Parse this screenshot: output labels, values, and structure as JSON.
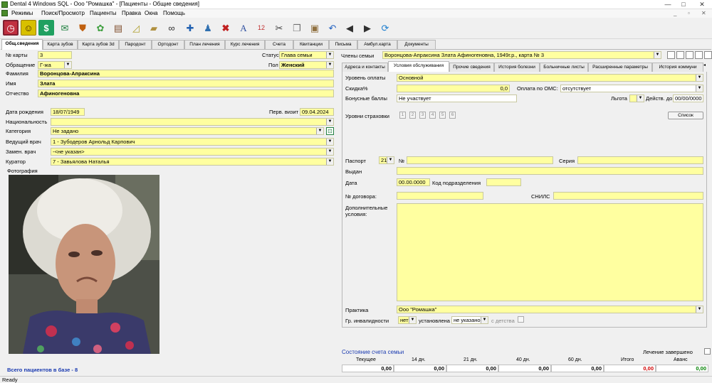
{
  "window": {
    "title": "Dental 4 Windows SQL - Ооо \"Ромашка\" - [Пациенты - Общие сведения]"
  },
  "menu": [
    "Режимы",
    "Поиск/Просмотр",
    "Пациенты",
    "Правка",
    "Окна",
    "Помощь"
  ],
  "toolbar_icons": [
    "clock-icon",
    "smiley-icon",
    "dollar-icon",
    "envelope-icon",
    "shield-icon",
    "gears-icon",
    "clipboard-icon",
    "chart-icon",
    "book-icon",
    "binoculars-icon",
    "add-user-icon",
    "users-icon",
    "delete-icon",
    "font-icon",
    "numbers-icon",
    "scissors-icon",
    "copy-icon",
    "paste-icon",
    "undo-icon",
    "prev-icon",
    "next-icon",
    "refresh-icon"
  ],
  "tabs": [
    "Общ.сведения",
    "Карта зубов",
    "Карта зубов 3d",
    "Пародонт",
    "Ортодонт",
    "План лечения",
    "Курс лечения",
    "Счета",
    "Квитанции",
    "Письма",
    "Амбул.карта",
    "Документы"
  ],
  "patient": {
    "card_label": "№ карты",
    "card": "3",
    "status_label": "Статус",
    "status": "Глава семьи",
    "address_label": "Обращение",
    "address": "Г-жа",
    "sex_label": "Пол",
    "sex": "Женский",
    "lastname_label": "Фамилия",
    "lastname": "Воронцова-Апраксина",
    "firstname_label": "Имя",
    "firstname": "Злата",
    "patronymic_label": "Отчество",
    "patronymic": "Афиногеновна",
    "birth_label": "Дата рождения",
    "birth": "18/07/1949",
    "first_visit_label": "Перв. визит",
    "first_visit": "09.04.2024",
    "nationality_label": "Национальность",
    "nationality": "",
    "category_label": "Категория",
    "category": "Не задано",
    "doctor_label": "Ведущий врач",
    "doctor": "1 - Зубодеров Арнольд Карпович",
    "sub_doctor_label": "Замен. врач",
    "sub_doctor": "-<не указан>",
    "curator_label": "Куратор",
    "curator": "7 - Завьялова Наталья",
    "photo_label": "Фотография"
  },
  "family": {
    "label": "Члены семьи",
    "value": "Воронцова-Апраксина Злата Афиногеновна, 1949г.р., карта № 3"
  },
  "subtabs": [
    "Адреса и контакты",
    "Условия обслуживания",
    "Прочие сведения",
    "История болезни",
    "Больничные листы",
    "Расширенные параметры",
    "История коммуни"
  ],
  "service": {
    "payment_level_label": "Уровень оплаты",
    "payment_level": "Основной",
    "discount_label": "Скидка%",
    "discount": "0,0",
    "oms_label": "Оплата по ОМС:",
    "oms": "отсутствует",
    "bonus_label": "Бонусные баллы",
    "bonus": "Не участвует",
    "benefit_label": "Льгота",
    "valid_label": "Действ. до",
    "valid": "00/00/0000",
    "insurance_label": "Уровни страховки",
    "insurance_levels": [
      "1",
      "2",
      "3",
      "4",
      "5",
      "6"
    ],
    "list_button": "Список",
    "passport_label": "Паспорт",
    "passport_type": "21",
    "number_label": "№",
    "series_label": "Серия",
    "issued_label": "Выдан",
    "date_label": "Дата",
    "date": "00.00.0000",
    "code_label": "Код подразделения",
    "contract_label": "№ договора:",
    "snils_label": "СНИЛС",
    "conditions_label": "Дополнительные условия:",
    "practice_label": "Практика",
    "practice": "Ооо \"Ромашка\"",
    "disability_label": "Гр. инвалидности",
    "disability": "нет",
    "established_label": "установлена",
    "established": "не указано",
    "childhood_label": "с детства"
  },
  "account": {
    "title": "Состояние счета семьи",
    "finished_label": "Лечение завершено",
    "headers": [
      "Текущее",
      "14 дн.",
      "21 дн.",
      "40 дн.",
      "60 дн.",
      "Итого",
      "Аванс"
    ],
    "values": [
      "0,00",
      "0,00",
      "0,00",
      "0,00",
      "0,00",
      "0,00",
      "0,00"
    ]
  },
  "total_patients": "Всего пациентов в базе - 8",
  "status": "Ready",
  "colors": {
    "field": "#ffffa0",
    "accent_blue": "#1a3ab0",
    "red": "#d00000",
    "green": "#008000"
  }
}
